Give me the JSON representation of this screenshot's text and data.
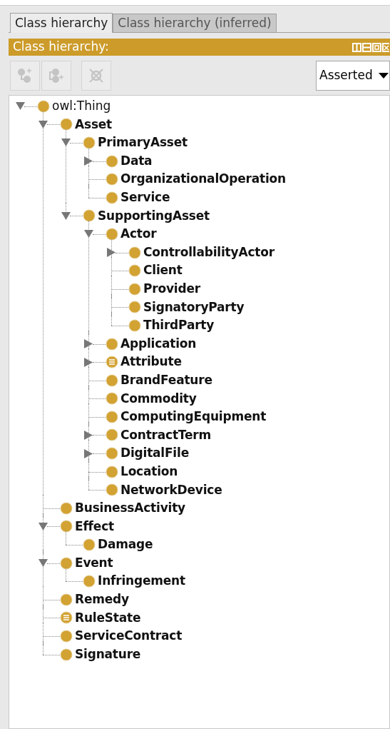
{
  "tabs": [
    {
      "label": "Class hierarchy",
      "selected": true
    },
    {
      "label": "Class hierarchy (inferred)",
      "selected": false
    }
  ],
  "panel": {
    "title": "Class hierarchy:"
  },
  "toolbar": {
    "buttons": [
      {
        "kind": "add-subclass",
        "disabled": true
      },
      {
        "kind": "add-sibling",
        "disabled": true
      },
      {
        "kind": "delete",
        "disabled": true
      }
    ],
    "dropdown": {
      "value": "Asserted"
    }
  },
  "tree": [
    {
      "label": "owl:Thing",
      "kind": "root",
      "expanded": true,
      "children": [
        {
          "label": "Asset",
          "kind": "class",
          "expanded": true,
          "children": [
            {
              "label": "PrimaryAsset",
              "kind": "class",
              "expanded": true,
              "children": [
                {
                  "label": "Data",
                  "kind": "class",
                  "expanded": false
                },
                {
                  "label": "OrganizationalOperation",
                  "kind": "class"
                },
                {
                  "label": "Service",
                  "kind": "class"
                }
              ]
            },
            {
              "label": "SupportingAsset",
              "kind": "class",
              "expanded": true,
              "children": [
                {
                  "label": "Actor",
                  "kind": "class",
                  "expanded": true,
                  "children": [
                    {
                      "label": "ControllabilityActor",
                      "kind": "class",
                      "expanded": false
                    },
                    {
                      "label": "Client",
                      "kind": "class"
                    },
                    {
                      "label": "Provider",
                      "kind": "class"
                    },
                    {
                      "label": "SignatoryParty",
                      "kind": "class"
                    },
                    {
                      "label": "ThirdParty",
                      "kind": "class"
                    }
                  ]
                },
                {
                  "label": "Application",
                  "kind": "class",
                  "expanded": false
                },
                {
                  "label": "Attribute",
                  "kind": "defined",
                  "expanded": false
                },
                {
                  "label": "BrandFeature",
                  "kind": "class"
                },
                {
                  "label": "Commodity",
                  "kind": "class"
                },
                {
                  "label": "ComputingEquipment",
                  "kind": "class"
                },
                {
                  "label": "ContractTerm",
                  "kind": "class",
                  "expanded": false
                },
                {
                  "label": "DigitalFile",
                  "kind": "class",
                  "expanded": false
                },
                {
                  "label": "Location",
                  "kind": "class"
                },
                {
                  "label": "NetworkDevice",
                  "kind": "class"
                }
              ]
            }
          ]
        },
        {
          "label": "BusinessActivity",
          "kind": "class"
        },
        {
          "label": "Effect",
          "kind": "class",
          "expanded": true,
          "children": [
            {
              "label": "Damage",
              "kind": "class"
            }
          ]
        },
        {
          "label": "Event",
          "kind": "class",
          "expanded": true,
          "children": [
            {
              "label": "Infringement",
              "kind": "class"
            }
          ]
        },
        {
          "label": "Remedy",
          "kind": "class"
        },
        {
          "label": "RuleState",
          "kind": "defined"
        },
        {
          "label": "ServiceContract",
          "kind": "class"
        },
        {
          "label": "Signature",
          "kind": "class"
        }
      ]
    }
  ]
}
